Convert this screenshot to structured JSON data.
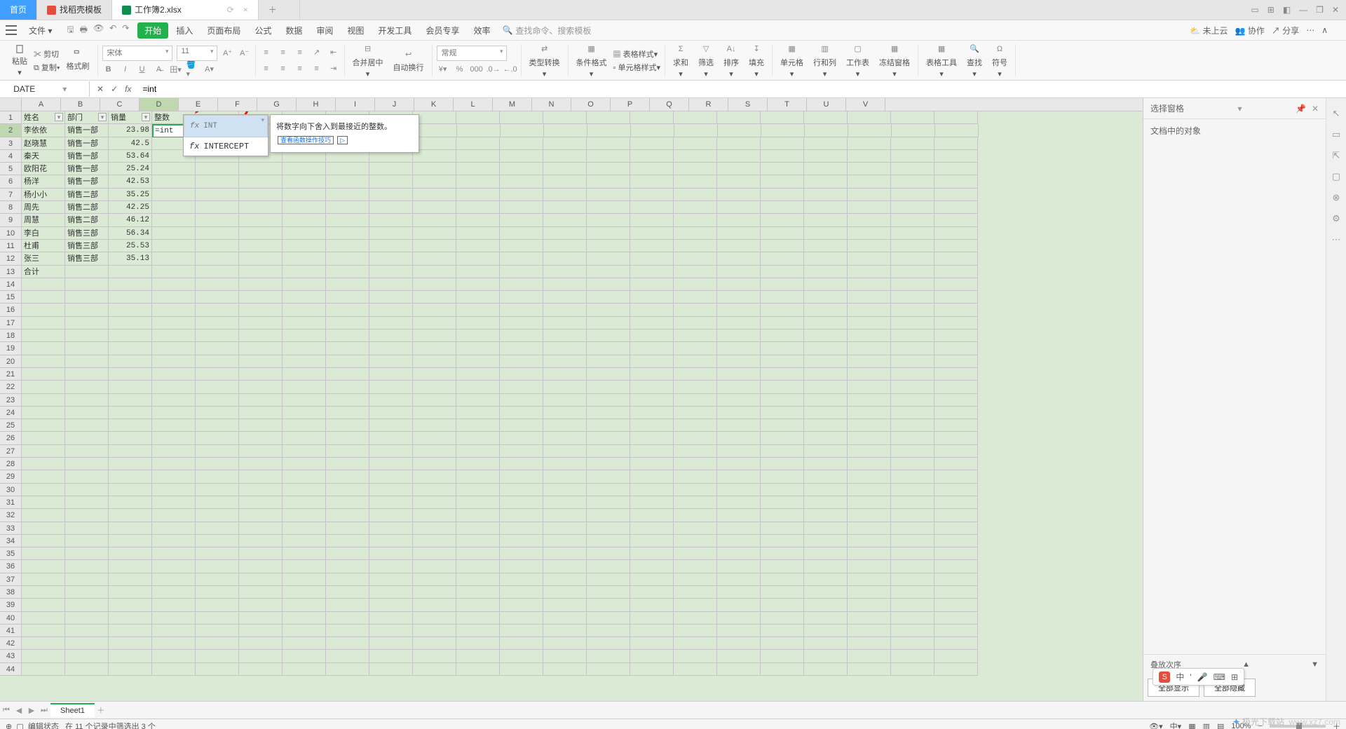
{
  "tabs": {
    "home": "首页",
    "template": "找稻壳模板",
    "workbook": "工作簿2.xlsx"
  },
  "window_ctl": {
    "min": "—",
    "restore": "❐",
    "close": "✕"
  },
  "menu": {
    "file": "文件",
    "items": [
      "开始",
      "插入",
      "页面布局",
      "公式",
      "数据",
      "审阅",
      "视图",
      "开发工具",
      "会员专享",
      "效率"
    ],
    "search": {
      "placeholder": "查找命令、搜索模板",
      "icon": "🔍"
    }
  },
  "menu_right": {
    "cloud": "未上云",
    "collab": "协作",
    "share": "分享"
  },
  "ribbon": {
    "paste": "粘贴",
    "cut": "剪切",
    "copy": "复制",
    "format_painter": "格式刷",
    "font": "宋体",
    "size": "11",
    "num_format": "常规",
    "merge": "合并居中",
    "wrap": "自动换行",
    "type_convert": "类型转换",
    "cond_fmt": "条件格式",
    "table_style": "表格样式",
    "cell_style": "单元格样式",
    "sum": "求和",
    "filter": "筛选",
    "sort": "排序",
    "fill": "填充",
    "cells": "单元格",
    "rowcol": "行和列",
    "sheet": "工作表",
    "freeze": "冻结窗格",
    "table_tools": "表格工具",
    "find": "查找",
    "symbol": "符号"
  },
  "fx": {
    "name": "DATE",
    "value": "=int"
  },
  "headers": [
    "A",
    "B",
    "C",
    "D",
    "E",
    "F",
    "G",
    "H",
    "I",
    "J",
    "K",
    "L",
    "M",
    "N",
    "O",
    "P",
    "Q",
    "R",
    "S",
    "T",
    "U",
    "V"
  ],
  "table": {
    "cols": [
      "姓名",
      "部门",
      "销量",
      "整数"
    ],
    "rows": [
      {
        "n": "李依依",
        "d": "销售一部",
        "v": "23.98",
        "cell": "=int"
      },
      {
        "n": "赵晓慧",
        "d": "销售一部",
        "v": "42.5"
      },
      {
        "n": "秦天",
        "d": "销售一部",
        "v": "53.64"
      },
      {
        "n": "欧阳花",
        "d": "销售一部",
        "v": "25.24"
      },
      {
        "n": "杨洋",
        "d": "销售一部",
        "v": "42.53"
      },
      {
        "n": "杨小小",
        "d": "销售二部",
        "v": "35.25"
      },
      {
        "n": "周先",
        "d": "销售二部",
        "v": "42.25"
      },
      {
        "n": "周慧",
        "d": "销售二部",
        "v": "46.12"
      },
      {
        "n": "李白",
        "d": "销售三部",
        "v": "56.34"
      },
      {
        "n": "杜甫",
        "d": "销售三部",
        "v": "25.53"
      },
      {
        "n": "张三",
        "d": "销售三部",
        "v": "35.13"
      },
      {
        "n": "合计",
        "d": "",
        "v": ""
      }
    ]
  },
  "fn_drop": {
    "items": [
      "INT",
      "INTERCEPT"
    ],
    "tip": "将数字向下舍入到最接近的整数。",
    "tip_link": "查看函数操作技巧"
  },
  "rpane": {
    "title": "选择窗格",
    "objects": "文档中的对象",
    "order": "叠放次序",
    "show_all": "全部显示",
    "hide_all": "全部隐藏"
  },
  "sheet": {
    "name": "Sheet1"
  },
  "status": {
    "mode": "编辑状态",
    "filter": "在 11 个记录中筛选出 3 个",
    "zoom": "100%"
  },
  "ime": {
    "lang": "中",
    "p": "'",
    "mic": "🎤"
  },
  "watermark": {
    "brand": "极光下载站",
    "url": "www.xz7.com"
  }
}
